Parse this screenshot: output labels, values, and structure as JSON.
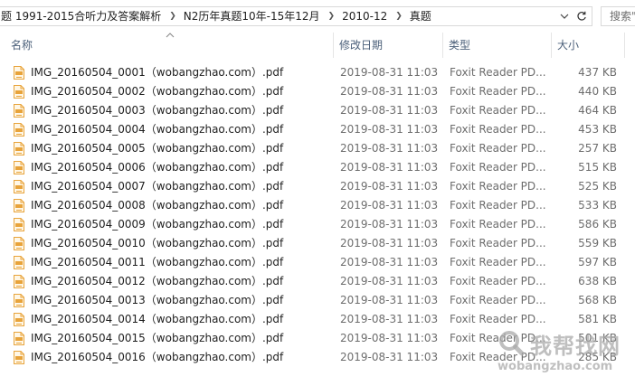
{
  "address_bar": {
    "crumbs": [
      "题 1991-2015合听力及答案解析",
      "N2历年真题10年-15年12月",
      "2010-12",
      "真题"
    ],
    "dropdown_icon": "chevron-down-icon",
    "refresh_icon": "refresh-icon",
    "search_placeholder": "搜索\"真题\""
  },
  "columns": {
    "name": "名称",
    "modified": "修改日期",
    "type": "类型",
    "size": "大小",
    "sort_icon": "sort-ascending-icon"
  },
  "files": [
    {
      "name": "IMG_20160504_0001（wobangzhao.com）.pdf",
      "modified": "2019-08-31 11:03",
      "type": "Foxit Reader PD...",
      "size": "437 KB"
    },
    {
      "name": "IMG_20160504_0002（wobangzhao.com）.pdf",
      "modified": "2019-08-31 11:03",
      "type": "Foxit Reader PD...",
      "size": "440 KB"
    },
    {
      "name": "IMG_20160504_0003（wobangzhao.com）.pdf",
      "modified": "2019-08-31 11:03",
      "type": "Foxit Reader PD...",
      "size": "464 KB"
    },
    {
      "name": "IMG_20160504_0004（wobangzhao.com）.pdf",
      "modified": "2019-08-31 11:03",
      "type": "Foxit Reader PD...",
      "size": "453 KB"
    },
    {
      "name": "IMG_20160504_0005（wobangzhao.com）.pdf",
      "modified": "2019-08-31 11:03",
      "type": "Foxit Reader PD...",
      "size": "257 KB"
    },
    {
      "name": "IMG_20160504_0006（wobangzhao.com）.pdf",
      "modified": "2019-08-31 11:03",
      "type": "Foxit Reader PD...",
      "size": "515 KB"
    },
    {
      "name": "IMG_20160504_0007（wobangzhao.com）.pdf",
      "modified": "2019-08-31 11:03",
      "type": "Foxit Reader PD...",
      "size": "525 KB"
    },
    {
      "name": "IMG_20160504_0008（wobangzhao.com）.pdf",
      "modified": "2019-08-31 11:03",
      "type": "Foxit Reader PD...",
      "size": "533 KB"
    },
    {
      "name": "IMG_20160504_0009（wobangzhao.com）.pdf",
      "modified": "2019-08-31 11:03",
      "type": "Foxit Reader PD...",
      "size": "586 KB"
    },
    {
      "name": "IMG_20160504_0010（wobangzhao.com）.pdf",
      "modified": "2019-08-31 11:03",
      "type": "Foxit Reader PD...",
      "size": "559 KB"
    },
    {
      "name": "IMG_20160504_0011（wobangzhao.com）.pdf",
      "modified": "2019-08-31 11:03",
      "type": "Foxit Reader PD...",
      "size": "597 KB"
    },
    {
      "name": "IMG_20160504_0012（wobangzhao.com）.pdf",
      "modified": "2019-08-31 11:03",
      "type": "Foxit Reader PD...",
      "size": "638 KB"
    },
    {
      "name": "IMG_20160504_0013（wobangzhao.com）.pdf",
      "modified": "2019-08-31 11:03",
      "type": "Foxit Reader PD...",
      "size": "568 KB"
    },
    {
      "name": "IMG_20160504_0014（wobangzhao.com）.pdf",
      "modified": "2019-08-31 11:03",
      "type": "Foxit Reader PD...",
      "size": "581 KB"
    },
    {
      "name": "IMG_20160504_0015（wobangzhao.com）.pdf",
      "modified": "2019-08-31 11:03",
      "type": "Foxit Reader PD...",
      "size": "501 KB"
    },
    {
      "name": "IMG_20160504_0016（wobangzhao.com）.pdf",
      "modified": "2019-08-31 11:03",
      "type": "Foxit Reader PD...",
      "size": "285 KB"
    }
  ],
  "file_icon": "pdf-file-icon",
  "watermark": {
    "text_cn": "我帮找网",
    "text_en": "wobangzhao.com"
  },
  "colors": {
    "header_text": "#4c607a",
    "secondary_text": "#6d6d6d",
    "pdf_icon": "#e8a33a"
  }
}
